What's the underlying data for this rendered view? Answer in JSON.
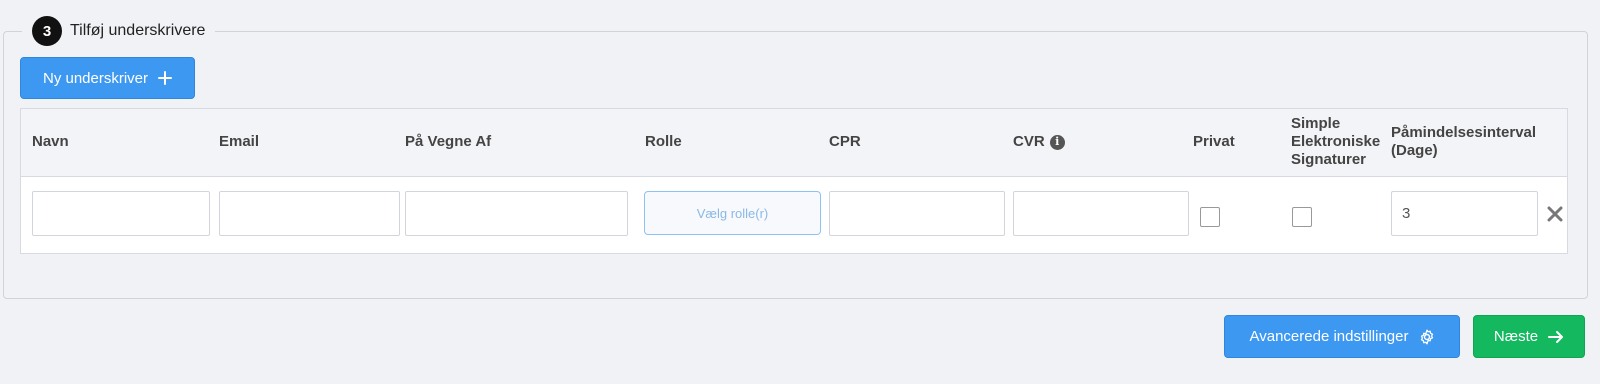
{
  "section": {
    "step": "3",
    "title": "Tilføj underskrivere"
  },
  "add_signer_button": "Ny underskriver",
  "table": {
    "columns": {
      "name": "Navn",
      "email": "Email",
      "on_behalf": "På Vegne Af",
      "role": "Rolle",
      "cpr": "CPR",
      "cvr": "CVR",
      "private": "Privat",
      "simple_signatures": "Simple Elektroniske Signaturer",
      "reminder_interval": "Påmindelsesinterval (Dage)"
    },
    "row": {
      "name": "",
      "email": "",
      "on_behalf": "",
      "role_placeholder": "Vælg rolle(r)",
      "cpr": "",
      "cvr": "",
      "private_checked": false,
      "simple_checked": false,
      "reminder_interval": "3"
    }
  },
  "footer": {
    "advanced_settings": "Avancerede indstillinger",
    "next": "Næste"
  },
  "colors": {
    "primary": "#3d98f2",
    "success": "#14b85e",
    "background": "#f1f2f6"
  }
}
